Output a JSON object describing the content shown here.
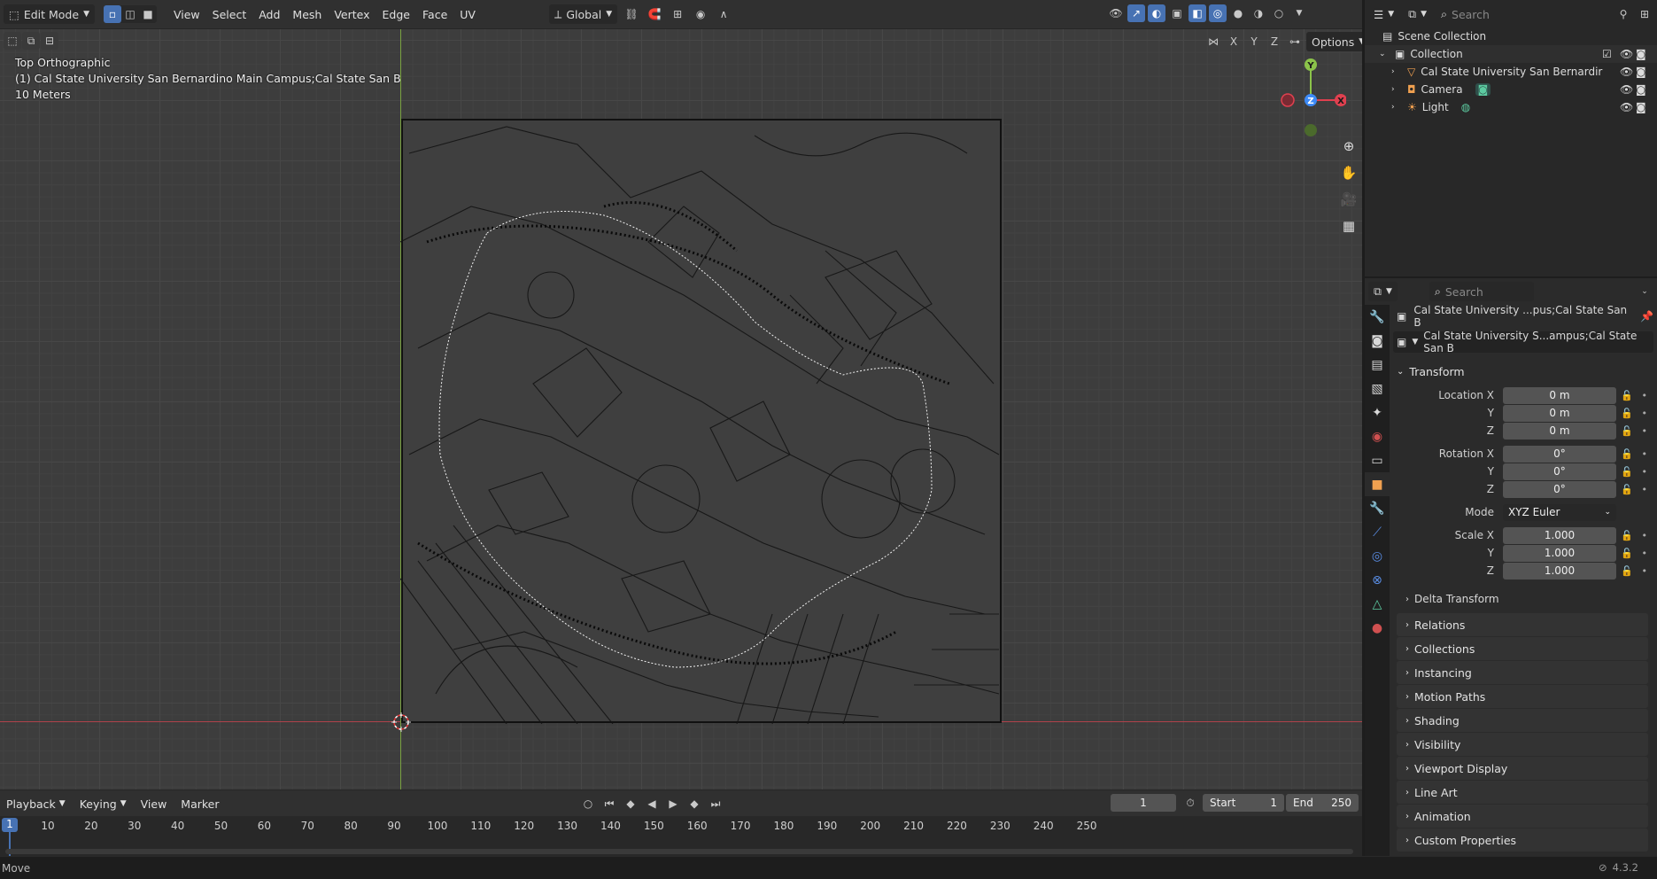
{
  "viewport_header": {
    "mode": "Edit Mode",
    "menus": [
      "View",
      "Select",
      "Add",
      "Mesh",
      "Vertex",
      "Edge",
      "Face",
      "UV"
    ],
    "orientation": "Global",
    "options_label": "Options",
    "axes": [
      "X",
      "Y",
      "Z"
    ]
  },
  "viewport": {
    "view_name": "Top Orthographic",
    "object_line": "(1) Cal State University San Bernardino Main Campus;Cal State San B",
    "scale_label": "10 Meters",
    "gizmo": {
      "y": "Y",
      "z": "Z",
      "x": "X"
    }
  },
  "timeline": {
    "menus": [
      "Playback",
      "Keying",
      "View",
      "Marker"
    ],
    "current_frame": "1",
    "start_label": "Start",
    "start_value": "1",
    "end_label": "End",
    "end_value": "250",
    "ticks": [
      "1",
      "10",
      "20",
      "30",
      "40",
      "50",
      "60",
      "70",
      "80",
      "90",
      "100",
      "110",
      "120",
      "130",
      "140",
      "150",
      "160",
      "170",
      "180",
      "190",
      "200",
      "210",
      "220",
      "230",
      "240",
      "250"
    ]
  },
  "status": {
    "left": "Move",
    "version": "4.3.2"
  },
  "outliner": {
    "search_placeholder": "Search",
    "root": "Scene Collection",
    "collection": "Collection",
    "items": [
      {
        "name": "Cal State University San Bernardir"
      },
      {
        "name": "Camera"
      },
      {
        "name": "Light"
      }
    ]
  },
  "properties": {
    "search_placeholder": "Search",
    "object_name": "Cal State University ...pus;Cal State San B",
    "data_name": "Cal State University S...ampus;Cal State San B",
    "transform_title": "Transform",
    "location": {
      "label_x": "Location X",
      "x": "0 m",
      "y": "0 m",
      "z": "0 m"
    },
    "rotation": {
      "label_x": "Rotation X",
      "x": "0°",
      "y": "0°",
      "z": "0°"
    },
    "mode_label": "Mode",
    "mode_value": "XYZ Euler",
    "scale": {
      "label_x": "Scale X",
      "x": "1.000",
      "y": "1.000",
      "z": "1.000"
    },
    "axis_y": "Y",
    "axis_z": "Z",
    "delta_transform": "Delta Transform",
    "panels": [
      "Relations",
      "Collections",
      "Instancing",
      "Motion Paths",
      "Shading",
      "Visibility",
      "Viewport Display",
      "Line Art",
      "Animation",
      "Custom Properties"
    ]
  },
  "colors": {
    "accent": "#4772b3",
    "x_axis": "#e0404f",
    "y_axis": "#8bc34a",
    "z_axis": "#3d8af7"
  }
}
